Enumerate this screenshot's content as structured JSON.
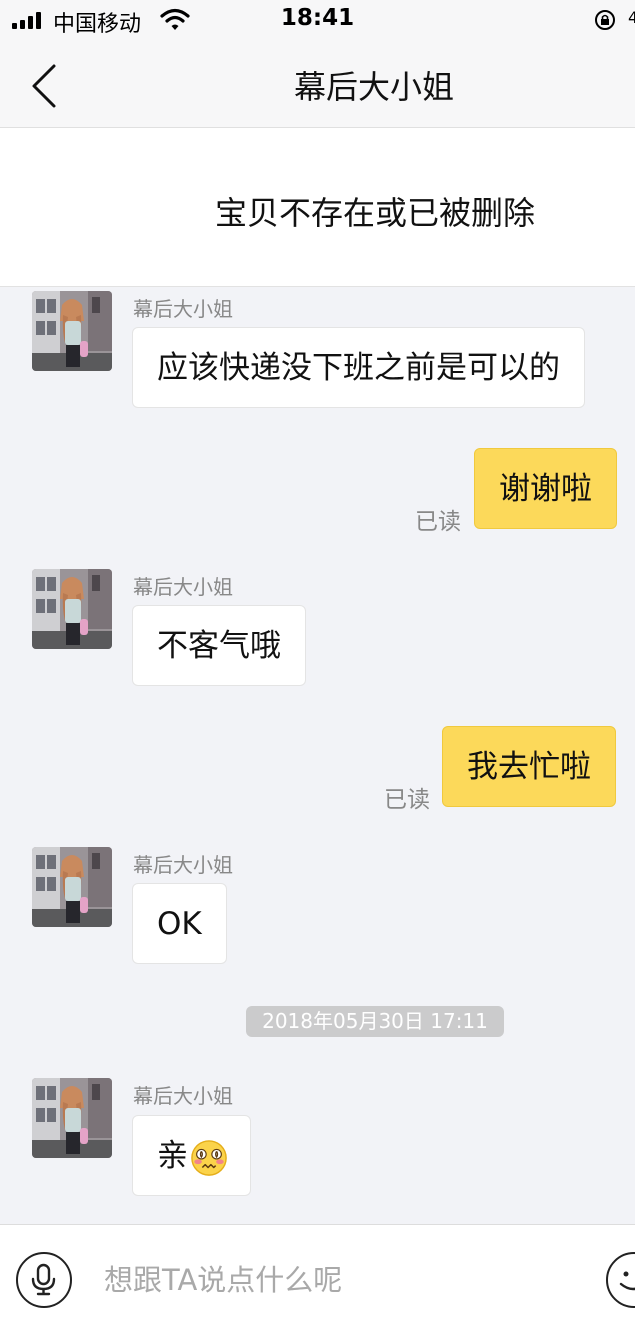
{
  "status_bar": {
    "carrier": "中国移动",
    "time": "18:41",
    "battery_edge": "4"
  },
  "nav": {
    "title": "幕后大小姐"
  },
  "notice": {
    "text": "宝贝不存在或已被删除"
  },
  "messages": [
    {
      "sender": "幕后大小姐",
      "text": "应该快递没下班之前是可以的"
    },
    {
      "text": "谢谢啦",
      "status": "已读"
    },
    {
      "sender": "幕后大小姐",
      "text": "不客气哦"
    },
    {
      "text": "我去忙啦",
      "status": "已读"
    },
    {
      "sender": "幕后大小姐",
      "text": "OK"
    },
    {
      "sender": "幕后大小姐",
      "text": "亲",
      "emoji": "dizzy-face-emoji"
    }
  ],
  "timestamp": "2018年05月30日 17:11",
  "input": {
    "placeholder": "想跟TA说点什么呢"
  },
  "colors": {
    "outgoing_bubble": "#fcd95a",
    "incoming_bubble": "#ffffff",
    "chat_background": "#f2f3f7"
  }
}
